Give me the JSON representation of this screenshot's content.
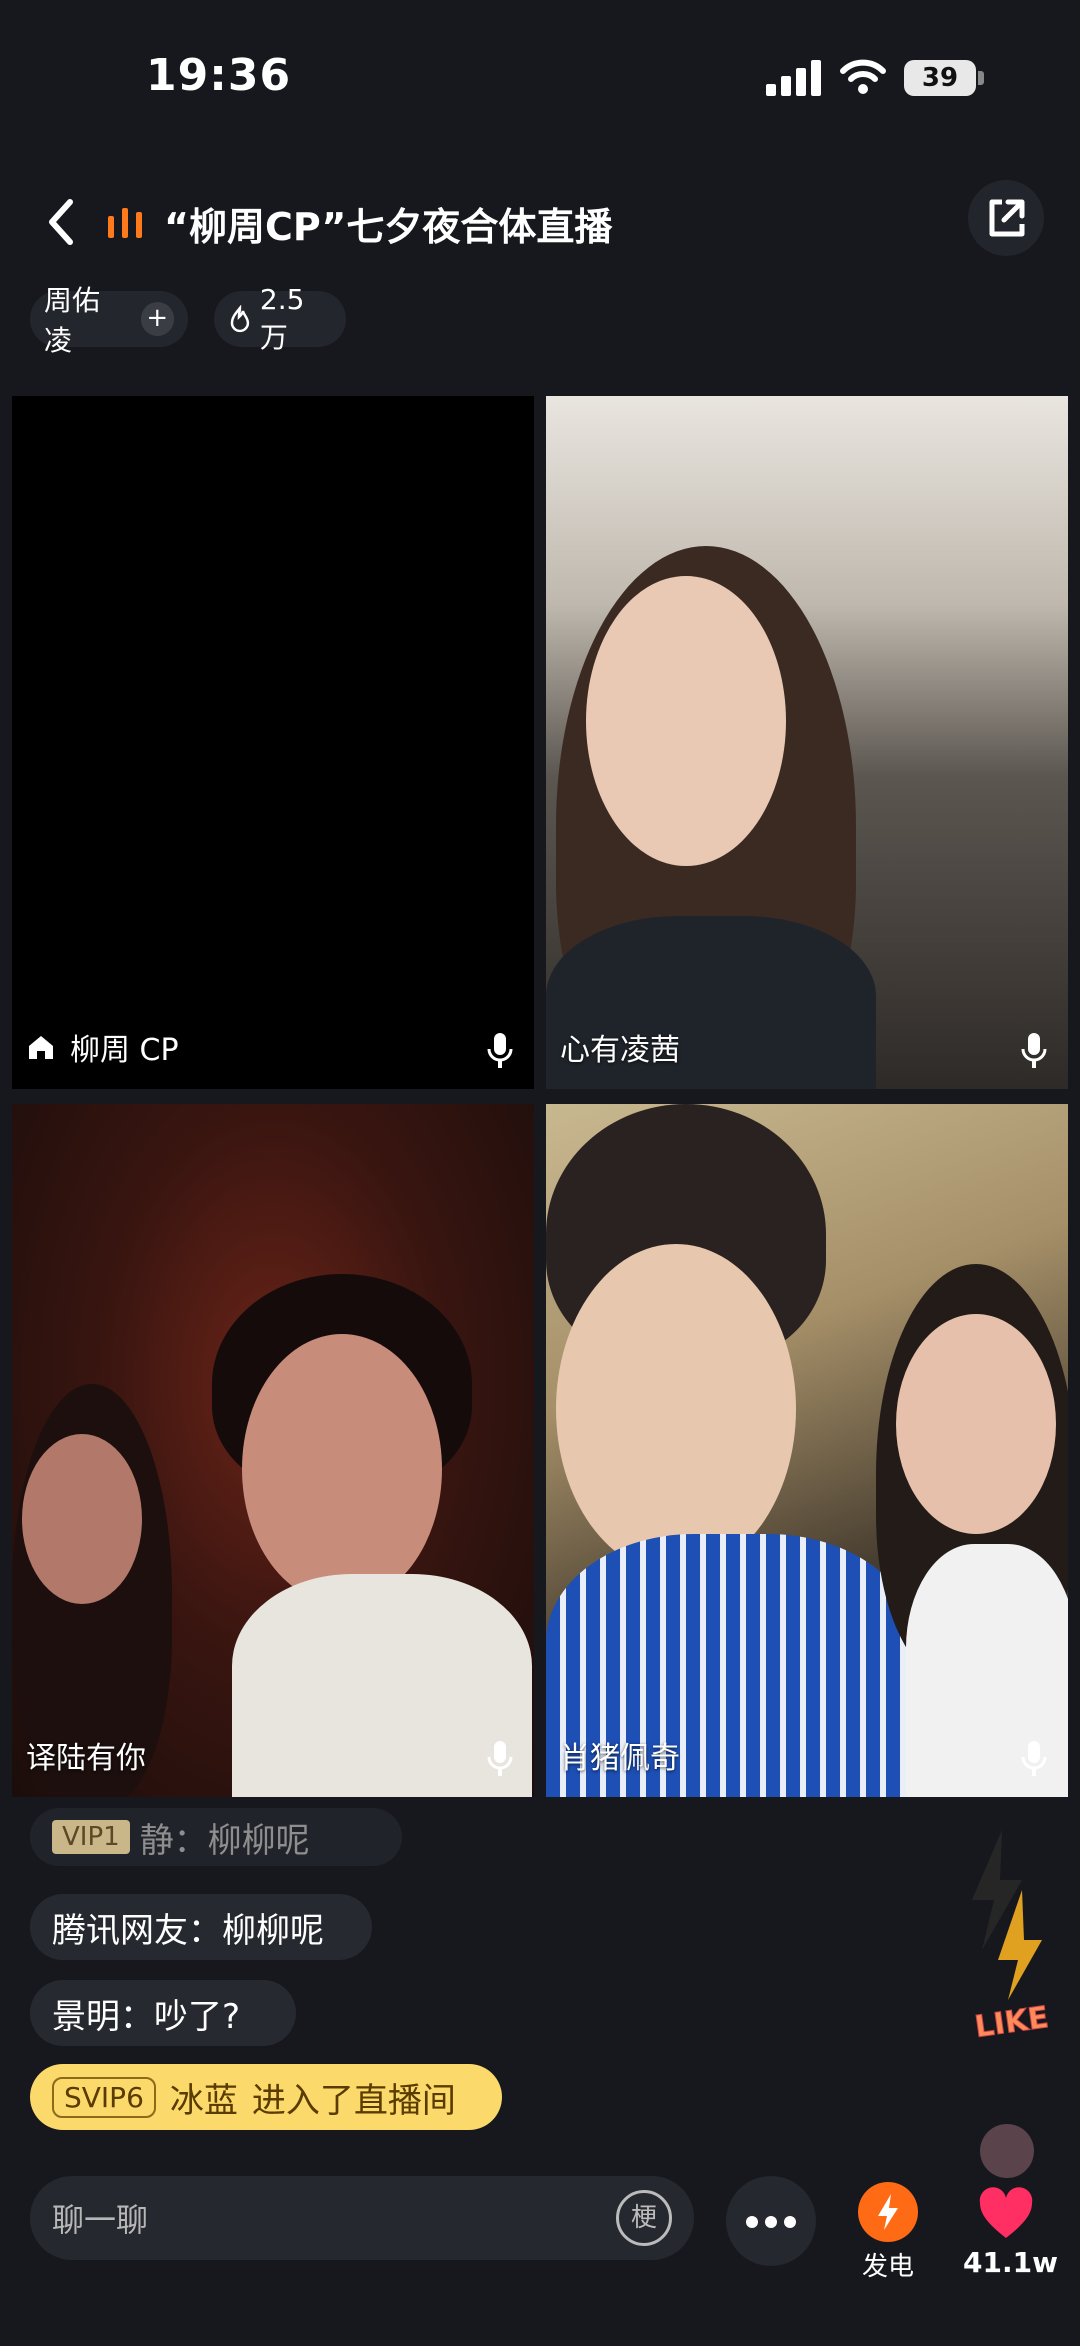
{
  "status_bar": {
    "time": "19:36",
    "battery": "39"
  },
  "header": {
    "title": "“柳周CP”七夕夜合体直播"
  },
  "host": {
    "name": "周佑凌",
    "follow": "+",
    "heat": "2.5万"
  },
  "tiles": [
    {
      "name": "柳周 CP",
      "is_host": true
    },
    {
      "name": "心有凌茜"
    },
    {
      "name": "译陆有你"
    },
    {
      "name": "肖猪佩奇"
    }
  ],
  "chat": {
    "messages": [
      {
        "badge": "VIP1",
        "text": "静：柳柳呢"
      },
      {
        "text": "腾讯网友：柳柳呢"
      },
      {
        "text": "景明：吵了?"
      }
    ],
    "entry": {
      "badge": "SVIP6",
      "user": "冰蓝",
      "action": "进入了直播间"
    }
  },
  "decor": {
    "like_sticker": "LIKE"
  },
  "bottom": {
    "input_placeholder": "聊一聊",
    "meme_label": "梗",
    "charge_label": "发电",
    "like_count": "41.1w"
  },
  "colors": {
    "accent": "#ff7a1a",
    "entry_bg": "#fbd96a",
    "like": "#ff2e63"
  }
}
